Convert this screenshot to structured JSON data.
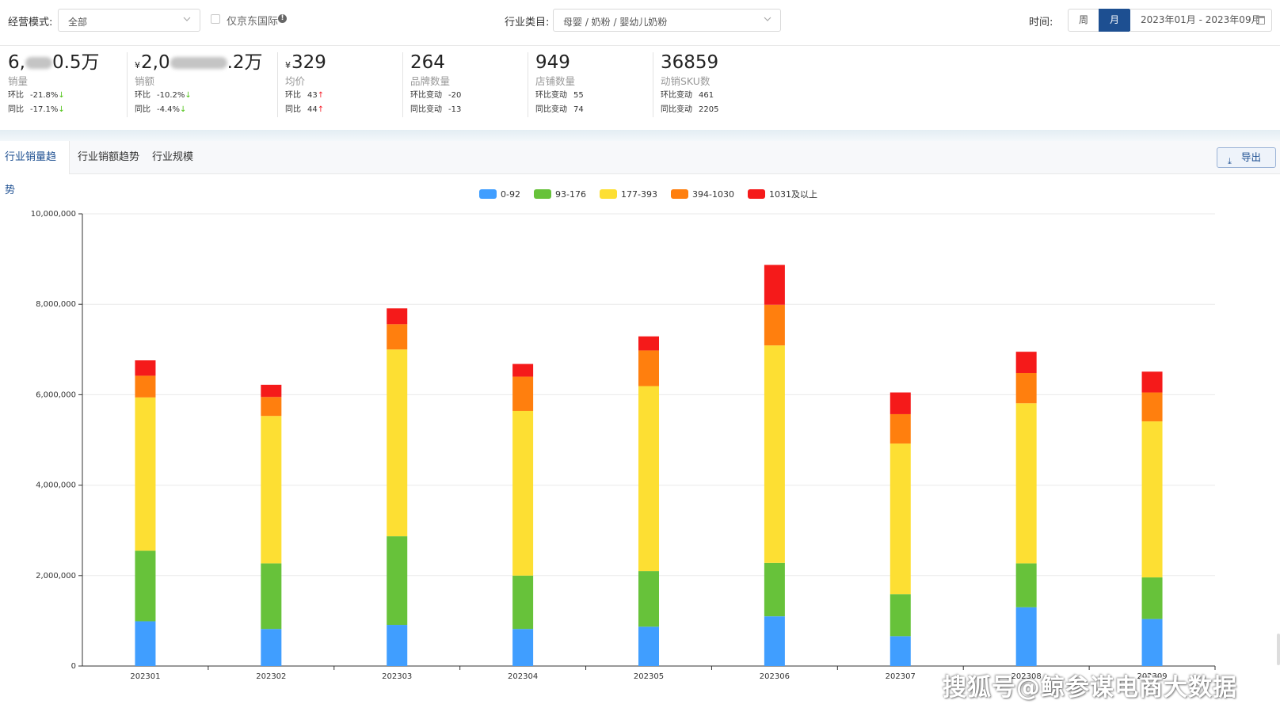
{
  "filters": {
    "mode_label": "经营模式:",
    "mode_value": "全部",
    "jd_intl_label": "仅京东国际",
    "info_symbol": "!",
    "category_label": "行业类目:",
    "category_value": "母婴 / 奶粉 / 婴幼儿奶粉",
    "time_label": "时间:",
    "week_label": "周",
    "month_label": "月",
    "date_range": "2023年01月 - 2023年09月"
  },
  "kpis": [
    {
      "value_pre": "6,",
      "value_post": "0.5万",
      "blurred": true,
      "label": "销量",
      "rows": [
        {
          "k": "环比",
          "v": "-21.8%",
          "dir": "down"
        },
        {
          "k": "同比",
          "v": "-17.1%",
          "dir": "down"
        }
      ]
    },
    {
      "currency": "¥",
      "value_pre": "2,0",
      "value_post": ".2万",
      "blurred": true,
      "label": "销额",
      "rows": [
        {
          "k": "环比",
          "v": "-10.2%",
          "dir": "down"
        },
        {
          "k": "同比",
          "v": "-4.4%",
          "dir": "down"
        }
      ]
    },
    {
      "currency": "¥",
      "value_pre": "329",
      "label": "均价",
      "rows": [
        {
          "k": "环比",
          "v": "43",
          "dir": "up"
        },
        {
          "k": "同比",
          "v": "44",
          "dir": "up"
        }
      ]
    },
    {
      "value_pre": "264",
      "label": "品牌数量",
      "rows": [
        {
          "k": "环比变动",
          "v": "-20"
        },
        {
          "k": "同比变动",
          "v": "-13"
        }
      ]
    },
    {
      "value_pre": "949",
      "label": "店铺数量",
      "rows": [
        {
          "k": "环比变动",
          "v": "55"
        },
        {
          "k": "同比变动",
          "v": "74"
        }
      ]
    },
    {
      "value_pre": "36859",
      "label": "动销SKU数",
      "rows": [
        {
          "k": "环比变动",
          "v": "461"
        },
        {
          "k": "同比变动",
          "v": "2205"
        }
      ]
    }
  ],
  "tabs": [
    "行业销量趋势",
    "行业销额趋势",
    "行业规模"
  ],
  "export_label": "导出",
  "export_icon": "download-icon",
  "chart_data": {
    "type": "bar",
    "stacked": true,
    "categories": [
      "202301",
      "202302",
      "202303",
      "202304",
      "202305",
      "202306",
      "202307",
      "202308",
      "202309"
    ],
    "series": [
      {
        "name": "0-92",
        "color": "#409eff",
        "values": [
          990000,
          820000,
          910000,
          820000,
          870000,
          1100000,
          660000,
          1300000,
          1040000
        ]
      },
      {
        "name": "93-176",
        "color": "#67c23a",
        "values": [
          1560000,
          1450000,
          1960000,
          1180000,
          1230000,
          1180000,
          930000,
          970000,
          920000
        ]
      },
      {
        "name": "177-393",
        "color": "#fddf33",
        "values": [
          3390000,
          3260000,
          4130000,
          3640000,
          4090000,
          4810000,
          3330000,
          3540000,
          3450000
        ]
      },
      {
        "name": "394-1030",
        "color": "#ff7f0e",
        "values": [
          480000,
          420000,
          560000,
          760000,
          790000,
          900000,
          650000,
          670000,
          640000
        ]
      },
      {
        "name": "1031及以上",
        "color": "#f51a1a",
        "values": [
          340000,
          270000,
          350000,
          280000,
          310000,
          880000,
          480000,
          470000,
          460000
        ]
      }
    ],
    "ylim": [
      0,
      10000000
    ],
    "yticks": [
      "0",
      "2,000,000",
      "4,000,000",
      "6,000,000",
      "8,000,000",
      "10,000,000"
    ],
    "grid": true,
    "legend": "top-center"
  },
  "watermark": "搜狐号@鲸参谋电商大数据"
}
